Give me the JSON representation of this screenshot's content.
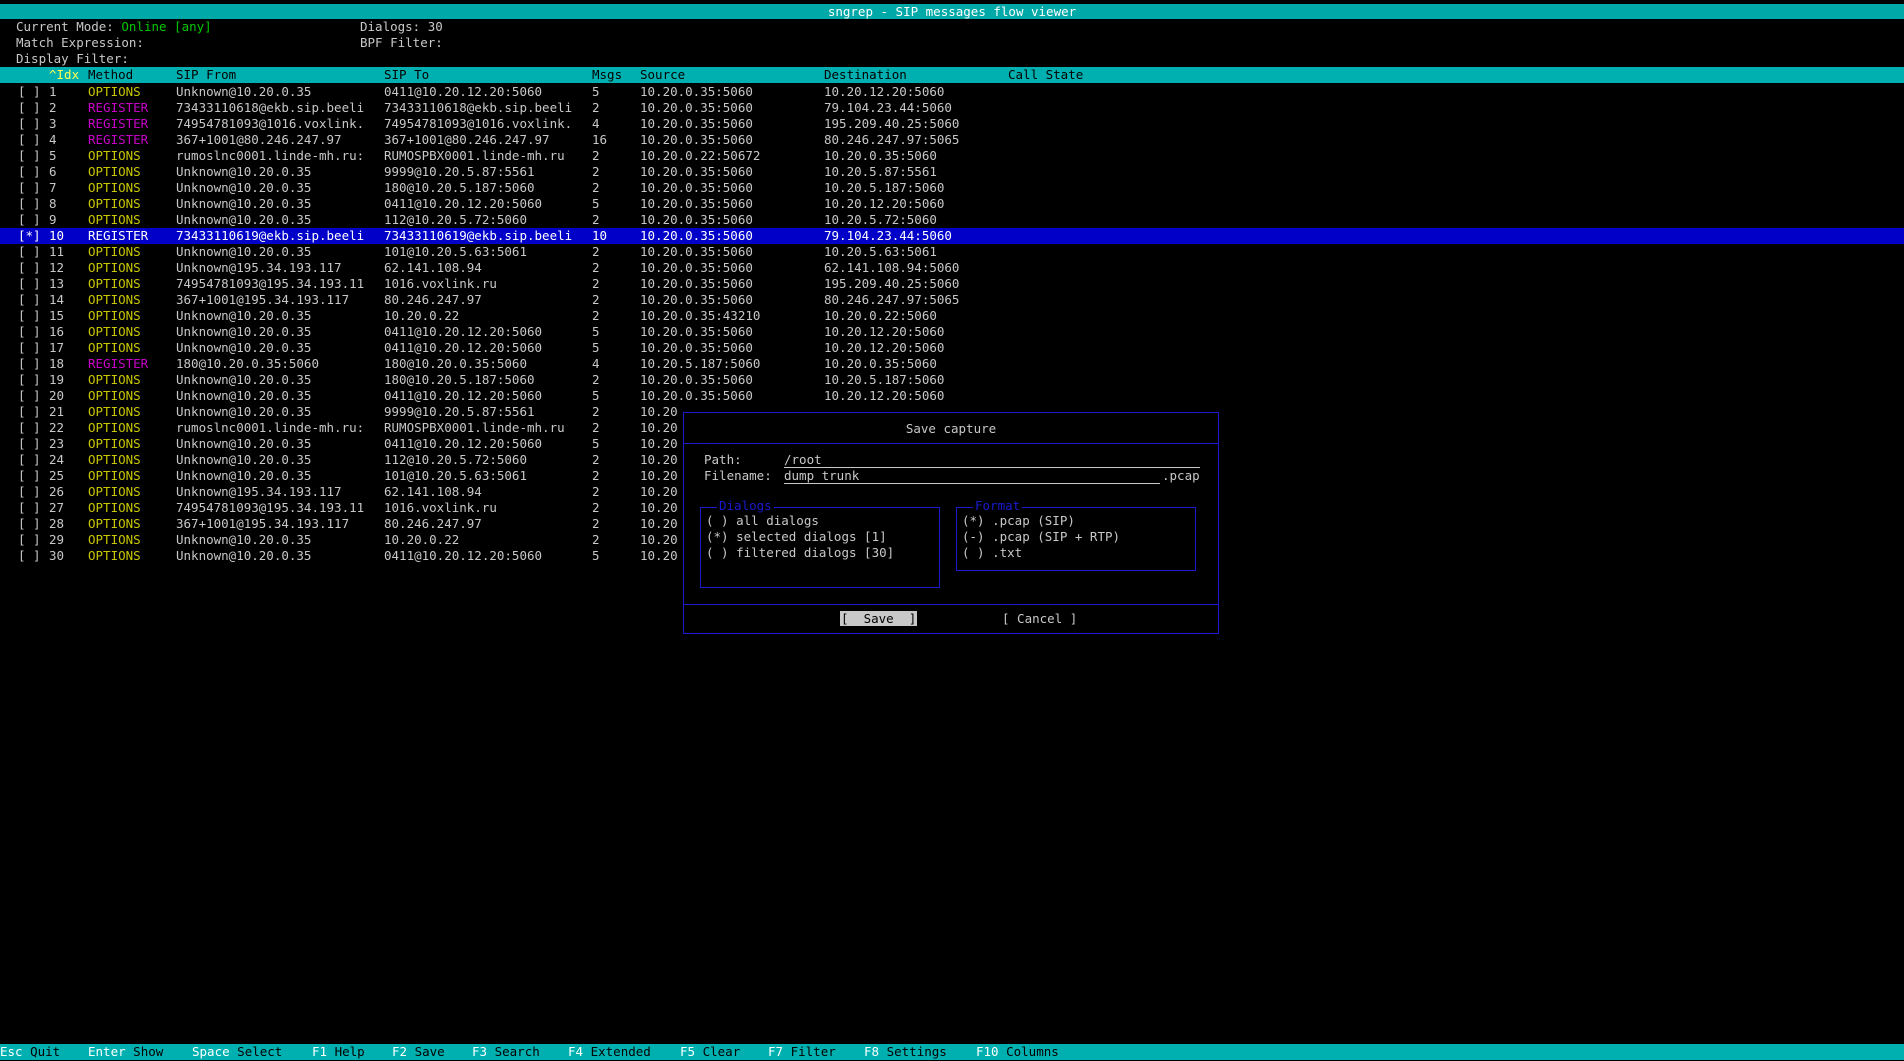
{
  "title": "sngrep - SIP messages flow viewer",
  "header": {
    "mode_label": "Current Mode:",
    "mode_value": "Online [any]",
    "dialogs_label": "Dialogs: 30",
    "match_label": "Match Expression:",
    "bpf_label": "BPF Filter:",
    "display_label": "Display Filter:"
  },
  "columns": [
    "^Idx",
    "Method",
    "SIP From",
    "SIP To",
    "Msgs",
    "Source",
    "Destination",
    "Call State"
  ],
  "rows": [
    {
      "sel": "[ ]",
      "idx": "1",
      "method": "OPTIONS",
      "from": "Unknown@10.20.0.35",
      "to": "0411@10.20.12.20:5060",
      "msgs": "5",
      "src": "10.20.0.35:5060",
      "dst": "10.20.12.20:5060"
    },
    {
      "sel": "[ ]",
      "idx": "2",
      "method": "REGISTER",
      "from": "73433110618@ekb.sip.beeli",
      "to": "73433110618@ekb.sip.beeli",
      "msgs": "2",
      "src": "10.20.0.35:5060",
      "dst": "79.104.23.44:5060"
    },
    {
      "sel": "[ ]",
      "idx": "3",
      "method": "REGISTER",
      "from": "74954781093@1016.voxlink.",
      "to": "74954781093@1016.voxlink.",
      "msgs": "4",
      "src": "10.20.0.35:5060",
      "dst": "195.209.40.25:5060"
    },
    {
      "sel": "[ ]",
      "idx": "4",
      "method": "REGISTER",
      "from": "367+1001@80.246.247.97",
      "to": "367+1001@80.246.247.97",
      "msgs": "16",
      "src": "10.20.0.35:5060",
      "dst": "80.246.247.97:5065"
    },
    {
      "sel": "[ ]",
      "idx": "5",
      "method": "OPTIONS",
      "from": "rumoslnc0001.linde-mh.ru:",
      "to": "RUMOSPBX0001.linde-mh.ru",
      "msgs": "2",
      "src": "10.20.0.22:50672",
      "dst": "10.20.0.35:5060"
    },
    {
      "sel": "[ ]",
      "idx": "6",
      "method": "OPTIONS",
      "from": "Unknown@10.20.0.35",
      "to": "9999@10.20.5.87:5561",
      "msgs": "2",
      "src": "10.20.0.35:5060",
      "dst": "10.20.5.87:5561"
    },
    {
      "sel": "[ ]",
      "idx": "7",
      "method": "OPTIONS",
      "from": "Unknown@10.20.0.35",
      "to": "180@10.20.5.187:5060",
      "msgs": "2",
      "src": "10.20.0.35:5060",
      "dst": "10.20.5.187:5060"
    },
    {
      "sel": "[ ]",
      "idx": "8",
      "method": "OPTIONS",
      "from": "Unknown@10.20.0.35",
      "to": "0411@10.20.12.20:5060",
      "msgs": "5",
      "src": "10.20.0.35:5060",
      "dst": "10.20.12.20:5060"
    },
    {
      "sel": "[ ]",
      "idx": "9",
      "method": "OPTIONS",
      "from": "Unknown@10.20.0.35",
      "to": "112@10.20.5.72:5060",
      "msgs": "2",
      "src": "10.20.0.35:5060",
      "dst": "10.20.5.72:5060"
    },
    {
      "sel": "[*]",
      "idx": "10",
      "method": "REGISTER",
      "from": "73433110619@ekb.sip.beeli",
      "to": "73433110619@ekb.sip.beeli",
      "msgs": "10",
      "src": "10.20.0.35:5060",
      "dst": "79.104.23.44:5060",
      "selected": true
    },
    {
      "sel": "[ ]",
      "idx": "11",
      "method": "OPTIONS",
      "from": "Unknown@10.20.0.35",
      "to": "101@10.20.5.63:5061",
      "msgs": "2",
      "src": "10.20.0.35:5060",
      "dst": "10.20.5.63:5061"
    },
    {
      "sel": "[ ]",
      "idx": "12",
      "method": "OPTIONS",
      "from": "Unknown@195.34.193.117",
      "to": "62.141.108.94",
      "msgs": "2",
      "src": "10.20.0.35:5060",
      "dst": "62.141.108.94:5060"
    },
    {
      "sel": "[ ]",
      "idx": "13",
      "method": "OPTIONS",
      "from": "74954781093@195.34.193.11",
      "to": "1016.voxlink.ru",
      "msgs": "2",
      "src": "10.20.0.35:5060",
      "dst": "195.209.40.25:5060"
    },
    {
      "sel": "[ ]",
      "idx": "14",
      "method": "OPTIONS",
      "from": "367+1001@195.34.193.117",
      "to": "80.246.247.97",
      "msgs": "2",
      "src": "10.20.0.35:5060",
      "dst": "80.246.247.97:5065"
    },
    {
      "sel": "[ ]",
      "idx": "15",
      "method": "OPTIONS",
      "from": "Unknown@10.20.0.35",
      "to": "10.20.0.22",
      "msgs": "2",
      "src": "10.20.0.35:43210",
      "dst": "10.20.0.22:5060"
    },
    {
      "sel": "[ ]",
      "idx": "16",
      "method": "OPTIONS",
      "from": "Unknown@10.20.0.35",
      "to": "0411@10.20.12.20:5060",
      "msgs": "5",
      "src": "10.20.0.35:5060",
      "dst": "10.20.12.20:5060"
    },
    {
      "sel": "[ ]",
      "idx": "17",
      "method": "OPTIONS",
      "from": "Unknown@10.20.0.35",
      "to": "0411@10.20.12.20:5060",
      "msgs": "5",
      "src": "10.20.0.35:5060",
      "dst": "10.20.12.20:5060"
    },
    {
      "sel": "[ ]",
      "idx": "18",
      "method": "REGISTER",
      "from": "180@10.20.0.35:5060",
      "to": "180@10.20.0.35:5060",
      "msgs": "4",
      "src": "10.20.5.187:5060",
      "dst": "10.20.0.35:5060"
    },
    {
      "sel": "[ ]",
      "idx": "19",
      "method": "OPTIONS",
      "from": "Unknown@10.20.0.35",
      "to": "180@10.20.5.187:5060",
      "msgs": "2",
      "src": "10.20.0.35:5060",
      "dst": "10.20.5.187:5060"
    },
    {
      "sel": "[ ]",
      "idx": "20",
      "method": "OPTIONS",
      "from": "Unknown@10.20.0.35",
      "to": "0411@10.20.12.20:5060",
      "msgs": "5",
      "src": "10.20.0.35:5060",
      "dst": "10.20.12.20:5060"
    },
    {
      "sel": "[ ]",
      "idx": "21",
      "method": "OPTIONS",
      "from": "Unknown@10.20.0.35",
      "to": "9999@10.20.5.87:5561",
      "msgs": "2",
      "src": "10.20",
      "dst": ""
    },
    {
      "sel": "[ ]",
      "idx": "22",
      "method": "OPTIONS",
      "from": "rumoslnc0001.linde-mh.ru:",
      "to": "RUMOSPBX0001.linde-mh.ru",
      "msgs": "2",
      "src": "10.20",
      "dst": ""
    },
    {
      "sel": "[ ]",
      "idx": "23",
      "method": "OPTIONS",
      "from": "Unknown@10.20.0.35",
      "to": "0411@10.20.12.20:5060",
      "msgs": "5",
      "src": "10.20",
      "dst": ""
    },
    {
      "sel": "[ ]",
      "idx": "24",
      "method": "OPTIONS",
      "from": "Unknown@10.20.0.35",
      "to": "112@10.20.5.72:5060",
      "msgs": "2",
      "src": "10.20",
      "dst": ""
    },
    {
      "sel": "[ ]",
      "idx": "25",
      "method": "OPTIONS",
      "from": "Unknown@10.20.0.35",
      "to": "101@10.20.5.63:5061",
      "msgs": "2",
      "src": "10.20",
      "dst": ""
    },
    {
      "sel": "[ ]",
      "idx": "26",
      "method": "OPTIONS",
      "from": "Unknown@195.34.193.117",
      "to": "62.141.108.94",
      "msgs": "2",
      "src": "10.20",
      "dst": ""
    },
    {
      "sel": "[ ]",
      "idx": "27",
      "method": "OPTIONS",
      "from": "74954781093@195.34.193.11",
      "to": "1016.voxlink.ru",
      "msgs": "2",
      "src": "10.20",
      "dst": ""
    },
    {
      "sel": "[ ]",
      "idx": "28",
      "method": "OPTIONS",
      "from": "367+1001@195.34.193.117",
      "to": "80.246.247.97",
      "msgs": "2",
      "src": "10.20",
      "dst": ""
    },
    {
      "sel": "[ ]",
      "idx": "29",
      "method": "OPTIONS",
      "from": "Unknown@10.20.0.35",
      "to": "10.20.0.22",
      "msgs": "2",
      "src": "10.20",
      "dst": ""
    },
    {
      "sel": "[ ]",
      "idx": "30",
      "method": "OPTIONS",
      "from": "Unknown@10.20.0.35",
      "to": "0411@10.20.12.20:5060",
      "msgs": "5",
      "src": "10.20",
      "dst": ""
    }
  ],
  "dialog": {
    "title": "Save capture",
    "path_label": "Path:",
    "path_value": "/root",
    "filename_label": "Filename:",
    "filename_value": "dump trunk",
    "filename_ext": ".pcap",
    "dialogs_box_label": "Dialogs",
    "dialogs_options": [
      "( ) all dialogs",
      "(*) selected dialogs [1]",
      "( ) filtered dialogs [30]"
    ],
    "format_box_label": "Format",
    "format_options": [
      "(*) .pcap (SIP)",
      "(-) .pcap (SIP + RTP)",
      "( ) .txt"
    ],
    "save_label": "[  Save  ]",
    "cancel_label": "[ Cancel ]"
  },
  "footer": [
    {
      "key": "Esc",
      "label": "Quit"
    },
    {
      "key": "Enter",
      "label": "Show"
    },
    {
      "key": "Space",
      "label": "Select"
    },
    {
      "key": "F1",
      "label": "Help"
    },
    {
      "key": "F2",
      "label": "Save"
    },
    {
      "key": "F3",
      "label": "Search"
    },
    {
      "key": "F4",
      "label": "Extended"
    },
    {
      "key": "F5",
      "label": "Clear"
    },
    {
      "key": "F7",
      "label": "Filter"
    },
    {
      "key": "F8",
      "label": "Settings"
    },
    {
      "key": "F10",
      "label": "Columns"
    }
  ],
  "colors": {
    "accent": "#00b0b0",
    "selected_row": "#0000c8",
    "options_method": "#c8c800",
    "register_method": "#c800c8",
    "mode_value": "#00c800",
    "dialog_border": "#1a1ad0"
  }
}
